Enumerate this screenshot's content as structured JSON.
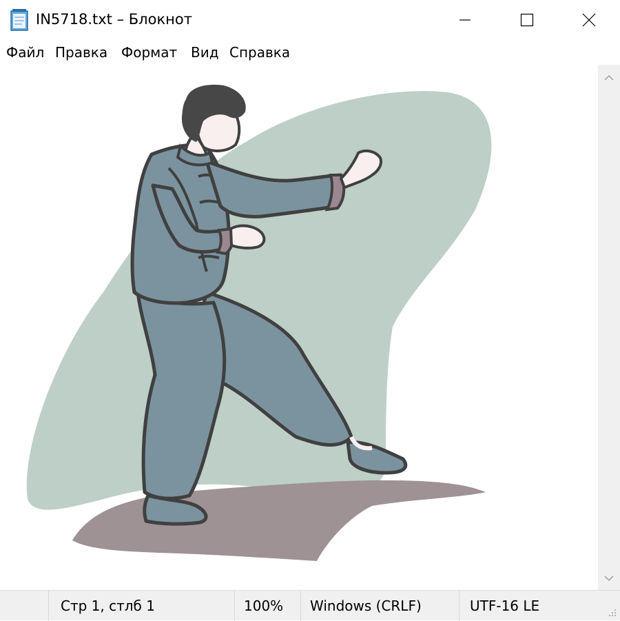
{
  "window": {
    "title": "IN5718.txt – Блокнот"
  },
  "menu": {
    "items": [
      "Файл",
      "Правка",
      "Формат",
      "Вид",
      "Справка"
    ]
  },
  "status": {
    "position": "Стр 1, стлб 1",
    "zoom": "100%",
    "line_endings": "Windows (CRLF)",
    "encoding": "UTF-16 LE"
  },
  "icons": {
    "app": "notepad-icon",
    "minimize": "minimize-icon",
    "maximize": "maximize-icon",
    "close": "close-icon",
    "scroll_up": "chevron-up-icon",
    "scroll_down": "chevron-down-icon",
    "grip": "resize-grip-icon"
  },
  "colors": {
    "background_blob": "#a7bfb3",
    "suit": "#4f6f7e",
    "suit_dark": "#2e4a58",
    "cuff": "#7a5f6a",
    "shadow": "#7d6e72",
    "skin": "#f8e9ea",
    "hair": "#0a0a0a"
  },
  "image": {
    "subject": "tai-chi-practitioner-clipart"
  }
}
